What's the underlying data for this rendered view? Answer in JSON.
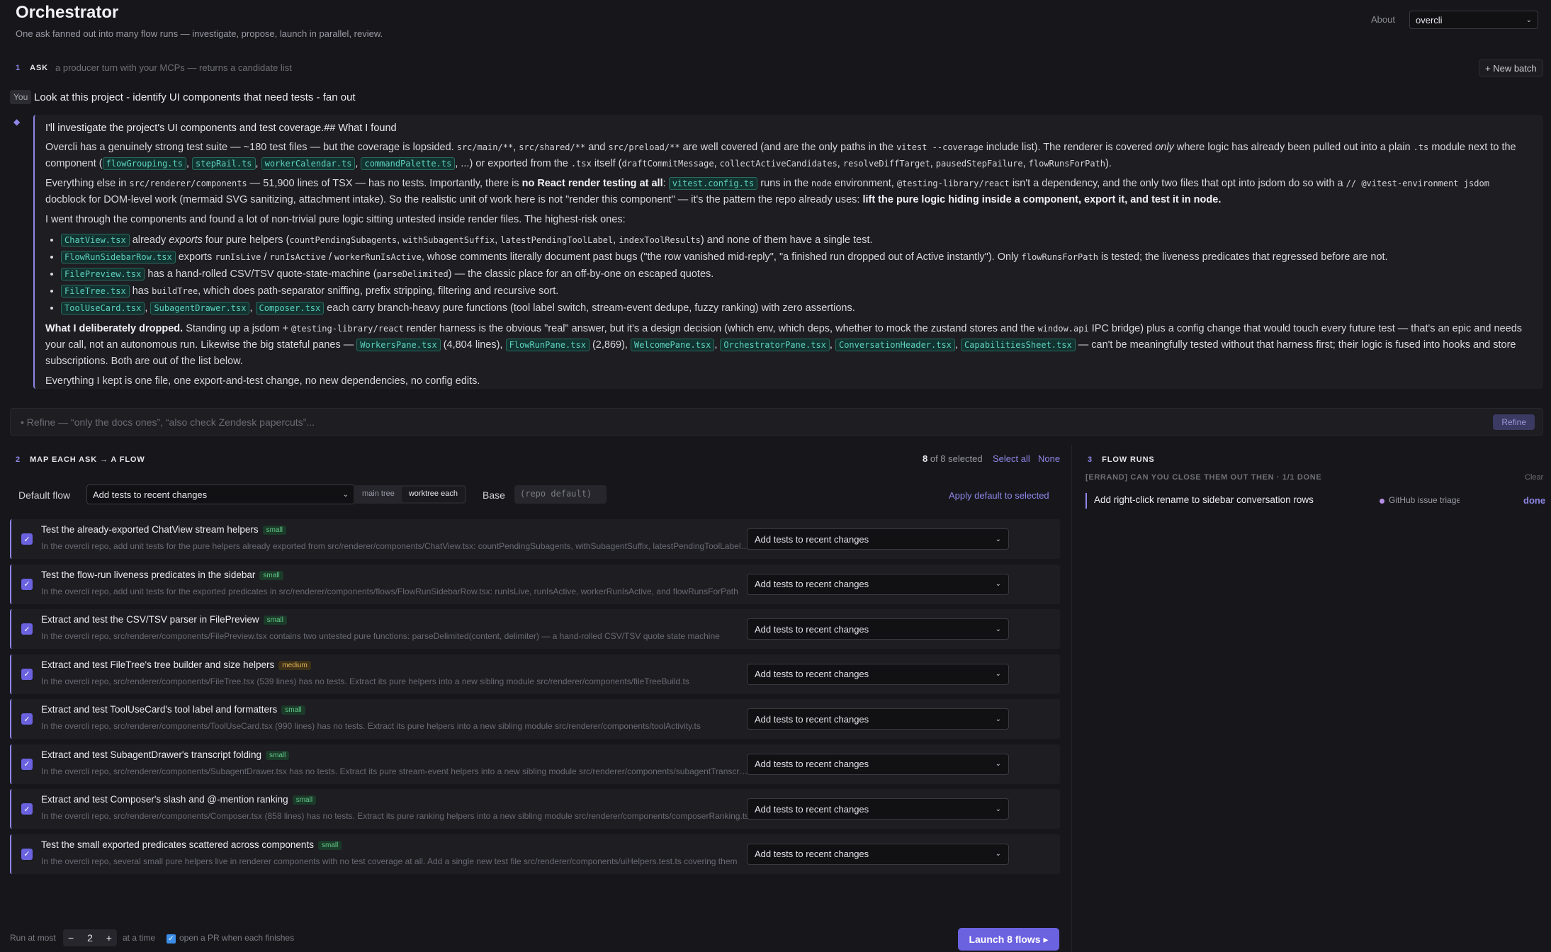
{
  "header": {
    "title": "Orchestrator",
    "subtitle": "One ask fanned out into many flow runs — investigate, propose, launch in parallel, review.",
    "about": "About",
    "project": "overcli"
  },
  "ask": {
    "num": "1",
    "label": "ASK",
    "desc": "a producer turn with your MCPs — returns a candidate list",
    "new_batch": "+ New batch",
    "you_badge": "You",
    "prompt": "Look at this project - identify UI components that need tests - fan out",
    "refine_placeholder": "Refine — “only the docs ones”, “also check Zendesk papercuts”...",
    "refine_button": "Refine"
  },
  "answer": {
    "p0": "I'll investigate the project's UI components and test coverage.## What I found",
    "p1_a": "Overcli has a genuinely strong test suite — ~180 test files — but the coverage is lopsided. ",
    "c1": "src/main/**",
    "c2": "src/shared/**",
    "p1_and": " and ",
    "c3": "src/preload/**",
    "p1_b": " are well covered (and are the only paths in the ",
    "c4": "vitest --coverage",
    "p1_c": " include list). The renderer is covered ",
    "p1_only": "only",
    "p1_d": " where logic has already been pulled out into a plain ",
    "c5": ".ts",
    "p1_e": " module next to the component (",
    "t1": "flowGrouping.ts",
    "t2": "stepRail.ts",
    "t3": "workerCalendar.ts",
    "t4": "commandPalette.ts",
    "p1_f": ", ...) or exported from the ",
    "c6": ".tsx",
    "p1_g": " itself (",
    "c7": "draftCommitMessage",
    "c8": "collectActiveCandidates",
    "c9": "resolveDiffTarget",
    "c10": "pausedStepFailure",
    "c11": "flowRunsForPath",
    "p1_h": ").",
    "p2_a": "Everything else in ",
    "c12": "src/renderer/components",
    "p2_b": " — 51,900 lines of TSX — has no tests. Importantly, there is ",
    "p2_bold": "no React render testing at all",
    "p2_c": ": ",
    "t5": "vitest.config.ts",
    "p2_d": " runs in the ",
    "c13": "node",
    "p2_e": " environment, ",
    "c14": "@testing-library/react",
    "p2_f": " isn't a dependency, and the only two files that opt into jsdom do so with a ",
    "c15": "// @vitest-environment jsdom",
    "p2_g": " docblock for DOM-level work (mermaid SVG sanitizing, attachment intake). So the realistic unit of work here is not \"render this component\" — it's the pattern the repo already uses: ",
    "p2_bold2": "lift the pure logic hiding inside a component, export it, and test it in node.",
    "p3": "I went through the components and found a lot of non-trivial pure logic sitting untested inside render files. The highest-risk ones:",
    "li1_t": "ChatView.tsx",
    "li1_a": " already ",
    "li1_em": "exports",
    "li1_b": " four pure helpers (",
    "li1_c1": "countPendingSubagents",
    "li1_c2": "withSubagentSuffix",
    "li1_c3": "latestPendingToolLabel",
    "li1_c4": "indexToolResults",
    "li1_c": ") and none of them have a single test.",
    "li2_t": "FlowRunSidebarRow.tsx",
    "li2_a": " exports ",
    "li2_c1": "runIsLive",
    "li2_c2": "runIsActive",
    "li2_c3": "workerRunIsActive",
    "li2_b": ", whose comments literally document past bugs (\"the row vanished mid-reply\", \"a finished run dropped out of Active instantly\"). Only ",
    "li2_c4": "flowRunsForPath",
    "li2_c": " is tested; the liveness predicates that regressed before are not.",
    "li3_t": "FilePreview.tsx",
    "li3_a": " has a hand-rolled CSV/TSV quote-state-machine (",
    "li3_c1": "parseDelimited",
    "li3_b": ") — the classic place for an off-by-one on escaped quotes.",
    "li4_t": "FileTree.tsx",
    "li4_a": " has ",
    "li4_c1": "buildTree",
    "li4_b": ", which does path-separator sniffing, prefix stripping, filtering and recursive sort.",
    "li5_t1": "ToolUseCard.tsx",
    "li5_t2": "SubagentDrawer.tsx",
    "li5_t3": "Composer.tsx",
    "li5_a": " each carry branch-heavy pure functions (tool label switch, stream-event dedupe, fuzzy ranking) with zero assertions.",
    "p4_bold": "What I deliberately dropped.",
    "p4_a": " Standing up a jsdom + ",
    "p4_c1": "@testing-library/react",
    "p4_b": " render harness is the obvious \"real\" answer, but it's a design decision (which env, which deps, whether to mock the zustand stores and the ",
    "p4_c2": "window.api",
    "p4_c": " IPC bridge) plus a config change that would touch every future test — that's an epic and needs your call, not an autonomous run. Likewise the big stateful panes — ",
    "p4_t1": "WorkersPane.tsx",
    "p4_d": " (4,804 lines), ",
    "p4_t2": "FlowRunPane.tsx",
    "p4_e": " (2,869), ",
    "p4_t3": "WelcomePane.tsx",
    "p4_t4": "OrchestratorPane.tsx",
    "p4_t5": "ConversationHeader.tsx",
    "p4_t6": "CapabilitiesSheet.tsx",
    "p4_f": " — can't be meaningfully tested without that harness first; their logic is fused into hooks and store subscriptions. Both are out of the list below.",
    "p5": "Everything I kept is one file, one export-and-test change, no new dependencies, no config edits.",
    "sep": ", ",
    "slash": " / "
  },
  "map": {
    "num": "2",
    "label": "MAP EACH ASK → A FLOW",
    "selected_count": "8",
    "selected_rest": " of 8 selected",
    "select_all": "Select all",
    "none": "None",
    "default_label": "Default flow",
    "default_value": "Add tests to recent changes",
    "seg_main": "main tree",
    "seg_worktree": "worktree each",
    "base_label": "Base",
    "base_placeholder": "(repo default)",
    "apply": "Apply default to selected",
    "rows": [
      {
        "title": "Test the already-exported ChatView stream helpers",
        "size": "small",
        "desc": "In the overcli repo, add unit tests for the pure helpers already exported from src/renderer/components/ChatView.tsx: countPendingSubagents, withSubagentSuffix, latestPendingToolLabel, indexToolResults",
        "flow": "Add tests to recent changes"
      },
      {
        "title": "Test the flow-run liveness predicates in the sidebar",
        "size": "small",
        "desc": "In the overcli repo, add unit tests for the exported predicates in src/renderer/components/flows/FlowRunSidebarRow.tsx: runIsLive, runIsActive, workerRunIsActive, and flowRunsForPath",
        "flow": "Add tests to recent changes"
      },
      {
        "title": "Extract and test the CSV/TSV parser in FilePreview",
        "size": "small",
        "desc": "In the overcli repo, src/renderer/components/FilePreview.tsx contains two untested pure functions: parseDelimited(content, delimiter) — a hand-rolled CSV/TSV quote state machine",
        "flow": "Add tests to recent changes"
      },
      {
        "title": "Extract and test FileTree's tree builder and size helpers",
        "size": "medium",
        "desc": "In the overcli repo, src/renderer/components/FileTree.tsx (539 lines) has no tests. Extract its pure helpers into a new sibling module src/renderer/components/fileTreeBuild.ts",
        "flow": "Add tests to recent changes"
      },
      {
        "title": "Extract and test ToolUseCard's tool label and formatters",
        "size": "small",
        "desc": "In the overcli repo, src/renderer/components/ToolUseCard.tsx (990 lines) has no tests. Extract its pure helpers into a new sibling module src/renderer/components/toolActivity.ts",
        "flow": "Add tests to recent changes"
      },
      {
        "title": "Extract and test SubagentDrawer's transcript folding",
        "size": "small",
        "desc": "In the overcli repo, src/renderer/components/SubagentDrawer.tsx has no tests. Extract its pure stream-event helpers into a new sibling module src/renderer/components/subagentTranscript.ts",
        "flow": "Add tests to recent changes"
      },
      {
        "title": "Extract and test Composer's slash and @-mention ranking",
        "size": "small",
        "desc": "In the overcli repo, src/renderer/components/Composer.tsx (858 lines) has no tests. Extract its pure ranking helpers into a new sibling module src/renderer/components/composerRanking.ts",
        "flow": "Add tests to recent changes"
      },
      {
        "title": "Test the small exported predicates scattered across components",
        "size": "small",
        "desc": "In the overcli repo, several small pure helpers live in renderer components with no test coverage at all. Add a single new test file src/renderer/components/uiHelpers.test.ts covering them",
        "flow": "Add tests to recent changes"
      }
    ]
  },
  "runs": {
    "num": "3",
    "label": "FLOW RUNS",
    "errand": "[ERRAND] CAN YOU CLOSE THEM OUT THEN · 1/1 DONE",
    "clear": "Clear",
    "items": [
      {
        "title": "Add right-click rename to sidebar conversation rows",
        "source": "GitHub issue triage",
        "status": "done"
      }
    ]
  },
  "footer": {
    "run_at_most": "Run at most",
    "minus": "−",
    "count": "2",
    "plus": "+",
    "at_a_time": "at a time",
    "pr_label": "open a PR when each finishes",
    "launch": "Launch 8 flows ▸"
  },
  "icons": {
    "check": "✓",
    "chevron": "⌄",
    "diamond": "◆",
    "bullet": "•"
  },
  "colors": {
    "accent": "#8f86e8",
    "button": "#6b62e0",
    "tag": "#5fd0c0",
    "background": "#17171b"
  }
}
